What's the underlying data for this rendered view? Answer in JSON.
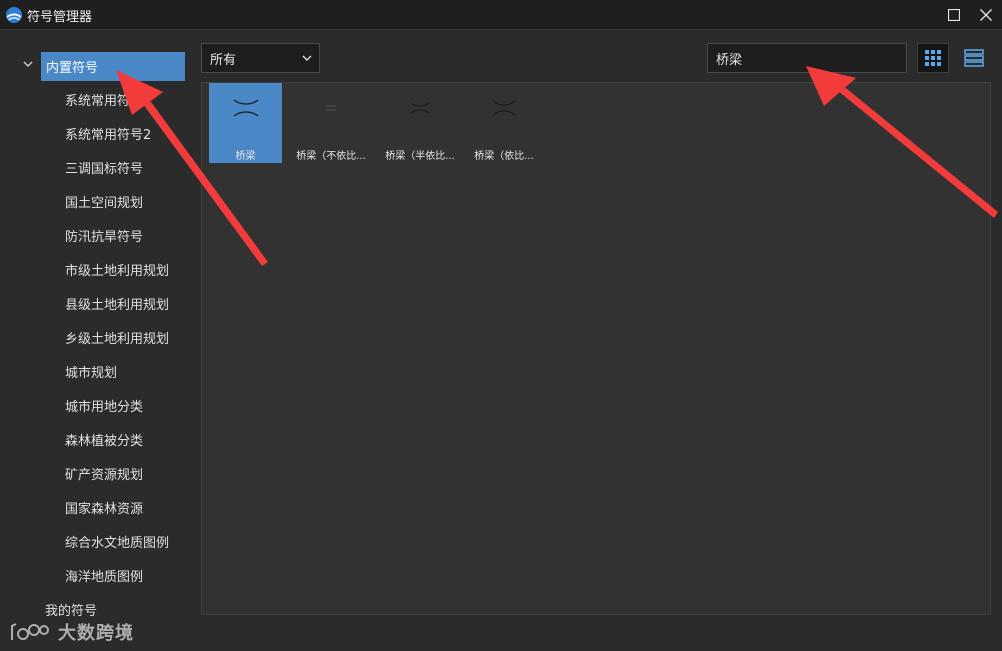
{
  "window": {
    "title": "符号管理器"
  },
  "sidebar": {
    "root_label": "内置符号",
    "items": [
      {
        "label": "系统常用符号"
      },
      {
        "label": "系统常用符号2"
      },
      {
        "label": "三调国标符号"
      },
      {
        "label": "国土空间规划"
      },
      {
        "label": "防汛抗旱符号"
      },
      {
        "label": "市级土地利用规划"
      },
      {
        "label": "县级土地利用规划"
      },
      {
        "label": "乡级土地利用规划"
      },
      {
        "label": "城市规划"
      },
      {
        "label": "城市用地分类"
      },
      {
        "label": "森林植被分类"
      },
      {
        "label": "矿产资源规划"
      },
      {
        "label": "国家森林资源"
      },
      {
        "label": "综合水文地质图例"
      },
      {
        "label": "海洋地质图例"
      }
    ],
    "root2_label": "我的符号"
  },
  "toolbar": {
    "filter_value": "所有",
    "search_value": "桥梁"
  },
  "symbols": [
    {
      "label": "桥梁",
      "selected": true
    },
    {
      "label": "桥梁（不依比...",
      "selected": false
    },
    {
      "label": "桥梁（半依比...",
      "selected": false
    },
    {
      "label": "桥梁（依比...",
      "selected": false
    }
  ],
  "watermark": {
    "text": "大数跨境"
  },
  "colors": {
    "selection": "#4a88c7",
    "annotation_arrow": "#f23b3b"
  }
}
